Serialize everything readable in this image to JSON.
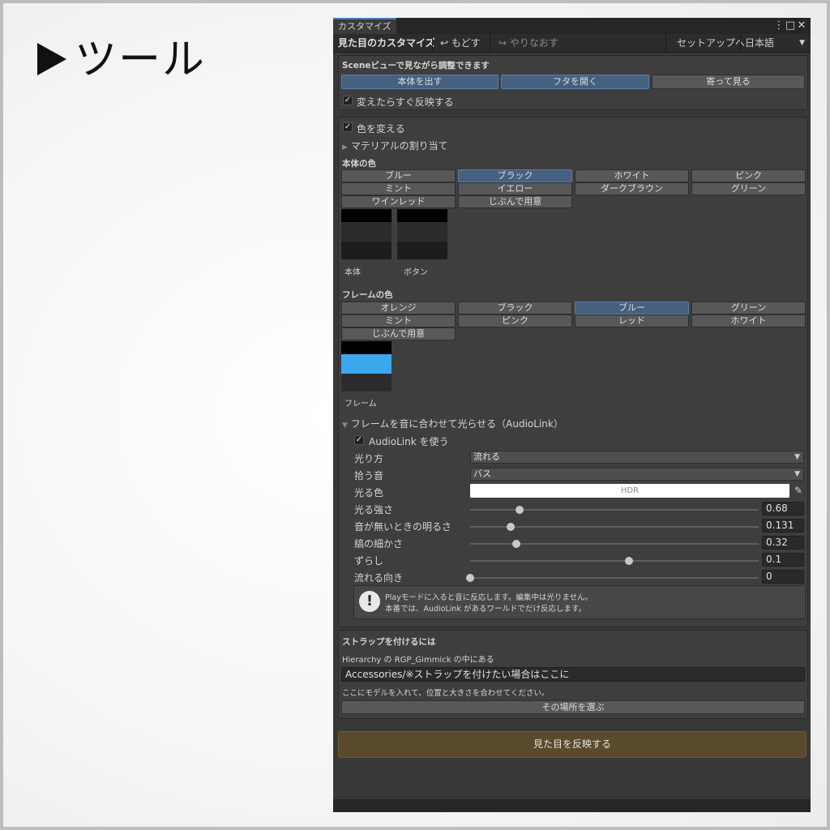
{
  "page_heading": "ツール",
  "window": {
    "tab_title": "カスタマイズ",
    "toolbar": {
      "title": "見た目のカスタマイズ",
      "undo": "もどす",
      "redo": "やりなおす",
      "setup": "セットアップへ",
      "language": "日本語"
    }
  },
  "scene_section": {
    "title": "Sceneビューで見ながら調整できます",
    "buttons": [
      "本体を出す",
      "フタを開く",
      "寄って見る"
    ],
    "auto_apply": "変えたらすぐ反映する"
  },
  "color_section": {
    "change_color": "色を変える",
    "material_assign": "マテリアルの割り当て",
    "body_color": {
      "title": "本体の色",
      "options": [
        "ブルー",
        "ブラック",
        "ホワイト",
        "ピンク",
        "ミント",
        "イエロー",
        "ダークブラウン",
        "グリーン",
        "ワインレッド",
        "じぶんで用意"
      ],
      "selected_index": 1,
      "swatches": [
        "本体",
        "ボタン"
      ]
    },
    "frame_color": {
      "title": "フレームの色",
      "options": [
        "オレンジ",
        "ブラック",
        "ブルー",
        "グリーン",
        "ミント",
        "ピンク",
        "レッド",
        "ホワイト",
        "じぶんで用意"
      ],
      "selected_index": 2,
      "swatch": "フレーム",
      "accent": "#3aa8ec"
    }
  },
  "audiolink": {
    "foldout": "フレームを音に合わせて光らせる（AudioLink）",
    "use": "AudioLink を使う",
    "rows": {
      "mode": {
        "label": "光り方",
        "value": "流れる"
      },
      "band": {
        "label": "拾う音",
        "value": "バス"
      },
      "color": {
        "label": "光る色",
        "value": "HDR"
      }
    },
    "sliders": [
      {
        "label": "光る強さ",
        "value": "0.68",
        "fraction": 0.17
      },
      {
        "label": "音が無いときの明るさ",
        "value": "0.131",
        "fraction": 0.14
      },
      {
        "label": "縞の細かさ",
        "value": "0.32",
        "fraction": 0.16
      },
      {
        "label": "ずらし",
        "value": "0.1",
        "fraction": 0.55
      },
      {
        "label": "流れる向き",
        "value": "0",
        "fraction": 0.0
      }
    ],
    "help_line1": "Playモードに入ると音に反応します。編集中は光りません。",
    "help_line2": "本番では、AudioLink があるワールドでだけ反応します。"
  },
  "strap_section": {
    "title": "ストラップを付けるには",
    "hint": "Hierarchy の RGP_Gimmick の中にある",
    "path_value": "Accessories/※ストラップを付けたい場合はここに",
    "note": "ここにモデルを入れて、位置と大きさを合わせてください。",
    "select_button": "その場所を選ぶ"
  },
  "apply_button": "見た目を反映する"
}
